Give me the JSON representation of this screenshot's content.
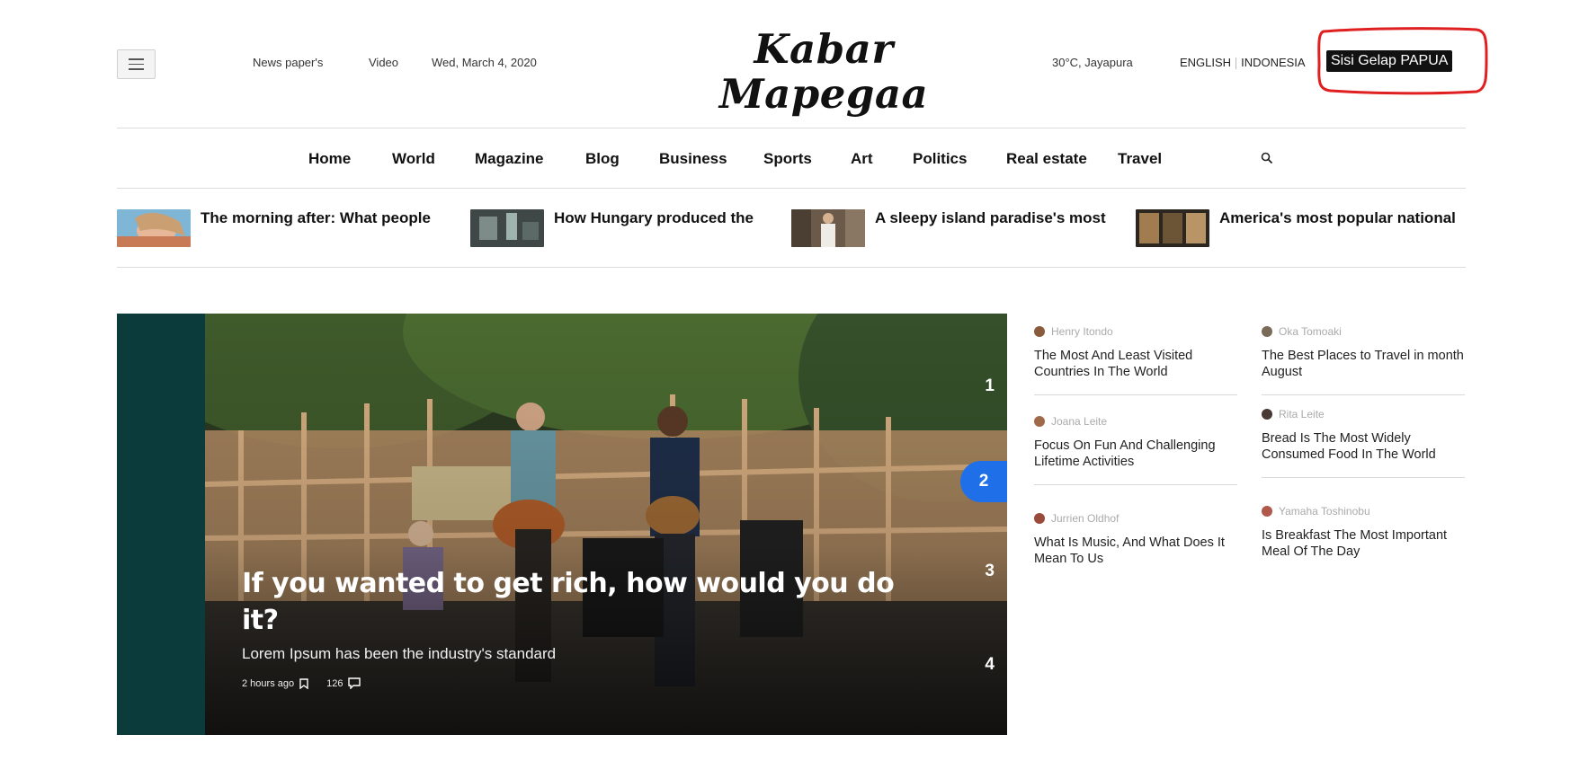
{
  "header": {
    "top_links": [
      "News paper's",
      "Video"
    ],
    "date": "Wed, March 4, 2020",
    "logo_text": "Kabar Mapegaa",
    "weather": "30°C, Jayapura",
    "lang_english": "ENGLISH",
    "lang_indonesia": "INDONESIA",
    "dark_mode_button": "Sisi Gelap PAPUA"
  },
  "nav": {
    "items": [
      "Home",
      "World",
      "Magazine",
      "Blog",
      "Business",
      "Sports",
      "Art",
      "Politics",
      "Real estate",
      "Travel"
    ]
  },
  "ticker": {
    "items": [
      {
        "title": "The morning after: What people"
      },
      {
        "title": "How Hungary produced the"
      },
      {
        "title": "A sleepy island paradise's most"
      },
      {
        "title": "America's most popular national"
      }
    ]
  },
  "hero": {
    "title": "If you wanted to get rich, how would you do it?",
    "subtitle": "Lorem Ipsum has been the industry's standard",
    "time": "2 hours ago",
    "comments": "126",
    "pages": [
      "1",
      "2",
      "3",
      "4"
    ],
    "active_page": "2"
  },
  "sidebar": {
    "left": [
      {
        "author": "Henry Itondo",
        "title": "The Most And Least Visited Countries In The World"
      },
      {
        "author": "Joana Leite",
        "title": "Focus On Fun And Challenging Lifetime Activities"
      },
      {
        "author": "Jurrien Oldhof",
        "title": "What Is Music, And What Does It Mean To Us"
      }
    ],
    "right": [
      {
        "author": "Oka Tomoaki",
        "title": "The Best Places to Travel in month August"
      },
      {
        "author": "Rita Leite",
        "title": "Bread Is The Most Widely Consumed Food In The World"
      },
      {
        "author": "Yamaha Toshinobu",
        "title": "Is Breakfast The Most Important Meal Of The Day"
      }
    ]
  },
  "colors": {
    "accent": "#1f6fe8",
    "annotation": "#e02020",
    "hero_panel": "#0b3b3a"
  }
}
